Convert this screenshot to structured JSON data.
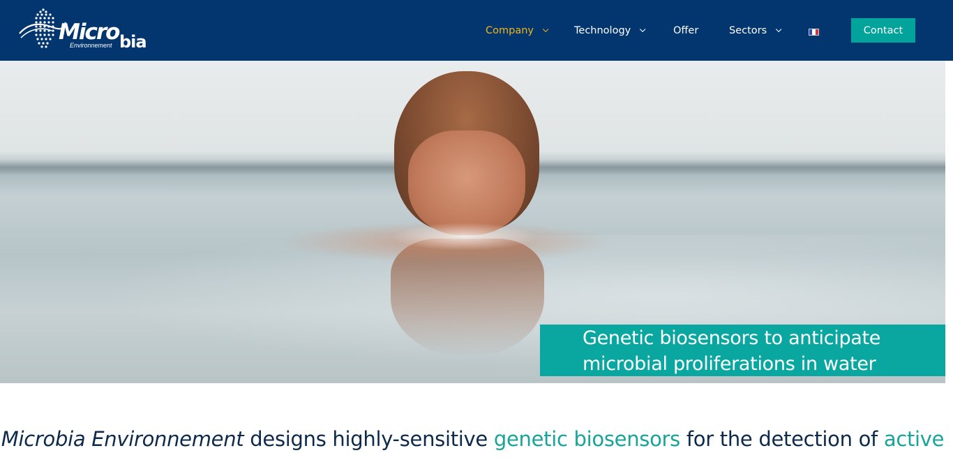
{
  "header": {
    "logo": {
      "main": "Micro",
      "main2": "bia",
      "sub": "Environnement",
      "icon": "microbia-logo-icon"
    },
    "nav": [
      {
        "label": "Company",
        "has_dropdown": true,
        "active": true
      },
      {
        "label": "Technology",
        "has_dropdown": true,
        "active": false
      },
      {
        "label": "Offer",
        "has_dropdown": false,
        "active": false
      },
      {
        "label": "Sectors",
        "has_dropdown": true,
        "active": false
      }
    ],
    "language_flag": "french-flag-icon",
    "contact_label": "Contact"
  },
  "hero": {
    "caption_line1": "Genetic biosensors to anticipate",
    "caption_line2": "microbial proliferations in water"
  },
  "intro": {
    "company": "Microbia Environnement",
    "part1": " designs highly-sensitive ",
    "highlight1": "genetic biosensors",
    "part2": " for the detection of ",
    "highlight2": "active"
  },
  "colors": {
    "header_bg": "#03366e",
    "nav_active": "#f0b41e",
    "contact_bg": "#02a39b",
    "caption_bg": "#0aa7a1",
    "text_dark": "#0d2a4d",
    "text_teal": "#17a59a"
  }
}
